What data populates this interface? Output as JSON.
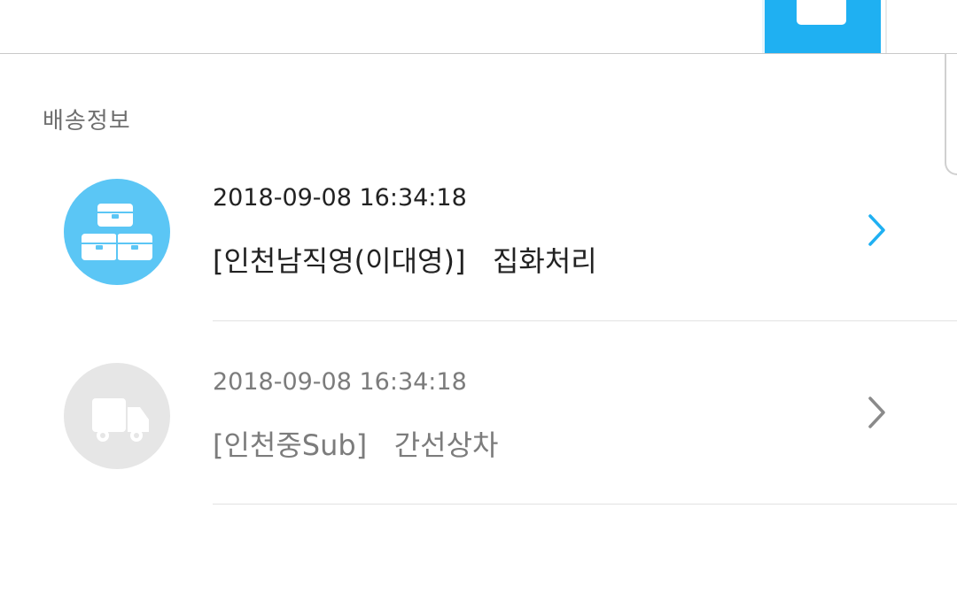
{
  "section": {
    "title": "배송정보"
  },
  "delivery": [
    {
      "date": "2018-09-08 16:34:18",
      "location": "[인천남직영(이대영)]",
      "status": "집화처리",
      "icon": "boxes-icon",
      "active": true,
      "color": "#5bc6f5"
    },
    {
      "date": "2018-09-08 16:34:18",
      "location": "[인천중Sub]",
      "status": "간선상차",
      "icon": "truck-icon",
      "active": false,
      "color": "#e6e6e6"
    }
  ],
  "colors": {
    "accent": "#1fb0f2",
    "active_text": "#222222",
    "inactive_text": "#7c7c7c"
  }
}
